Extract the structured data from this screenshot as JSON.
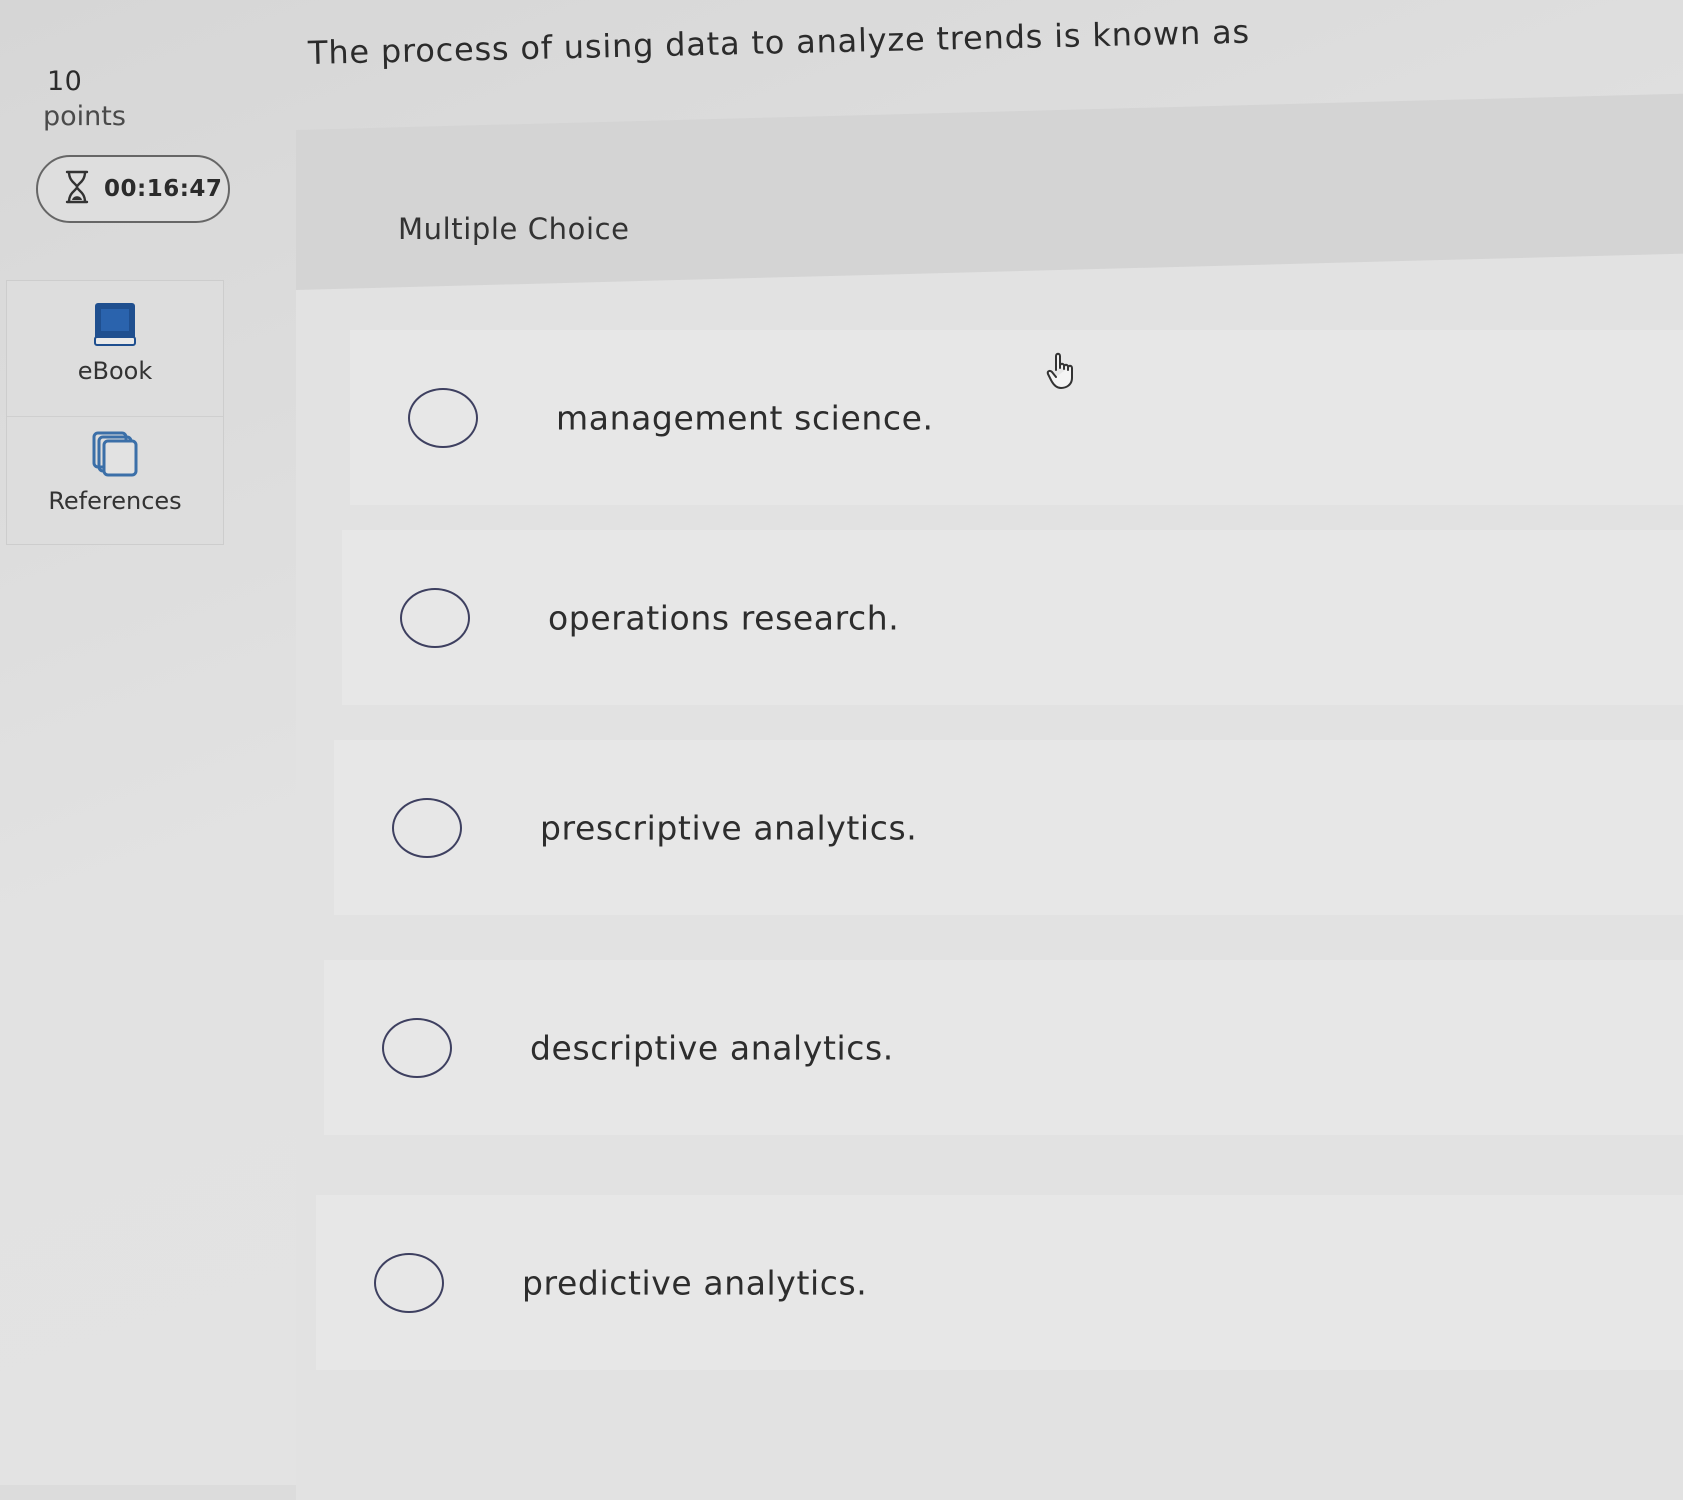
{
  "question": {
    "number_points": "10",
    "points_label": "points",
    "text": "The process of using data to analyze trends is known as",
    "type_label": "Multiple Choice"
  },
  "timer": {
    "icon": "hourglass-icon",
    "value": "00:16:47"
  },
  "tools": {
    "ebook": {
      "label": "eBook",
      "icon": "book-icon",
      "color": "#1f4f8f"
    },
    "references": {
      "label": "References",
      "icon": "references-icon",
      "color": "#3b6fa8"
    }
  },
  "choices": [
    {
      "label": "management science."
    },
    {
      "label": "operations research."
    },
    {
      "label": "prescriptive analytics."
    },
    {
      "label": "descriptive analytics."
    },
    {
      "label": "predictive analytics."
    }
  ]
}
